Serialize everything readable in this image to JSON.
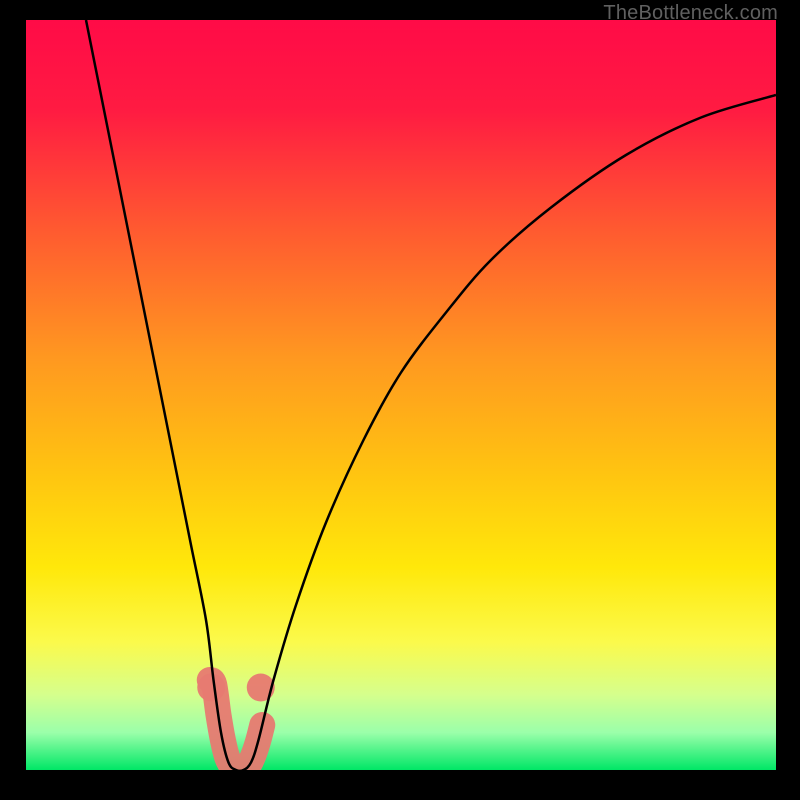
{
  "watermark": "TheBottleneck.com",
  "chart_data": {
    "type": "line",
    "title": "",
    "xlabel": "",
    "ylabel": "",
    "xlim": [
      0,
      100
    ],
    "ylim": [
      0,
      100
    ],
    "grid": false,
    "legend": false,
    "background_gradient": {
      "stops": [
        {
          "offset": 0.0,
          "color": "#ff0b47"
        },
        {
          "offset": 0.12,
          "color": "#ff1b42"
        },
        {
          "offset": 0.28,
          "color": "#ff5a30"
        },
        {
          "offset": 0.45,
          "color": "#ff9820"
        },
        {
          "offset": 0.6,
          "color": "#ffc311"
        },
        {
          "offset": 0.73,
          "color": "#ffe80a"
        },
        {
          "offset": 0.83,
          "color": "#fbfa4c"
        },
        {
          "offset": 0.9,
          "color": "#d5ff8d"
        },
        {
          "offset": 0.95,
          "color": "#9bffaa"
        },
        {
          "offset": 1.0,
          "color": "#00e766"
        }
      ]
    },
    "series": [
      {
        "name": "bottleneck-curve",
        "x": [
          8,
          10,
          12,
          14,
          16,
          18,
          20,
          22,
          24,
          25,
          26,
          27,
          28,
          29,
          30,
          31,
          33,
          36,
          40,
          45,
          50,
          56,
          62,
          70,
          80,
          90,
          100
        ],
        "y": [
          100,
          90,
          80,
          70,
          60,
          50,
          40,
          30,
          20,
          12,
          5,
          1,
          0,
          0,
          1,
          4,
          12,
          22,
          33,
          44,
          53,
          61,
          68,
          75,
          82,
          87,
          90
        ],
        "stroke": "#000000"
      }
    ],
    "highlight_region": {
      "name": "optimal-zone",
      "shape": "u",
      "x_range": [
        24.5,
        31.5
      ],
      "y_range": [
        0,
        12
      ],
      "fill": "#e77a71"
    }
  }
}
